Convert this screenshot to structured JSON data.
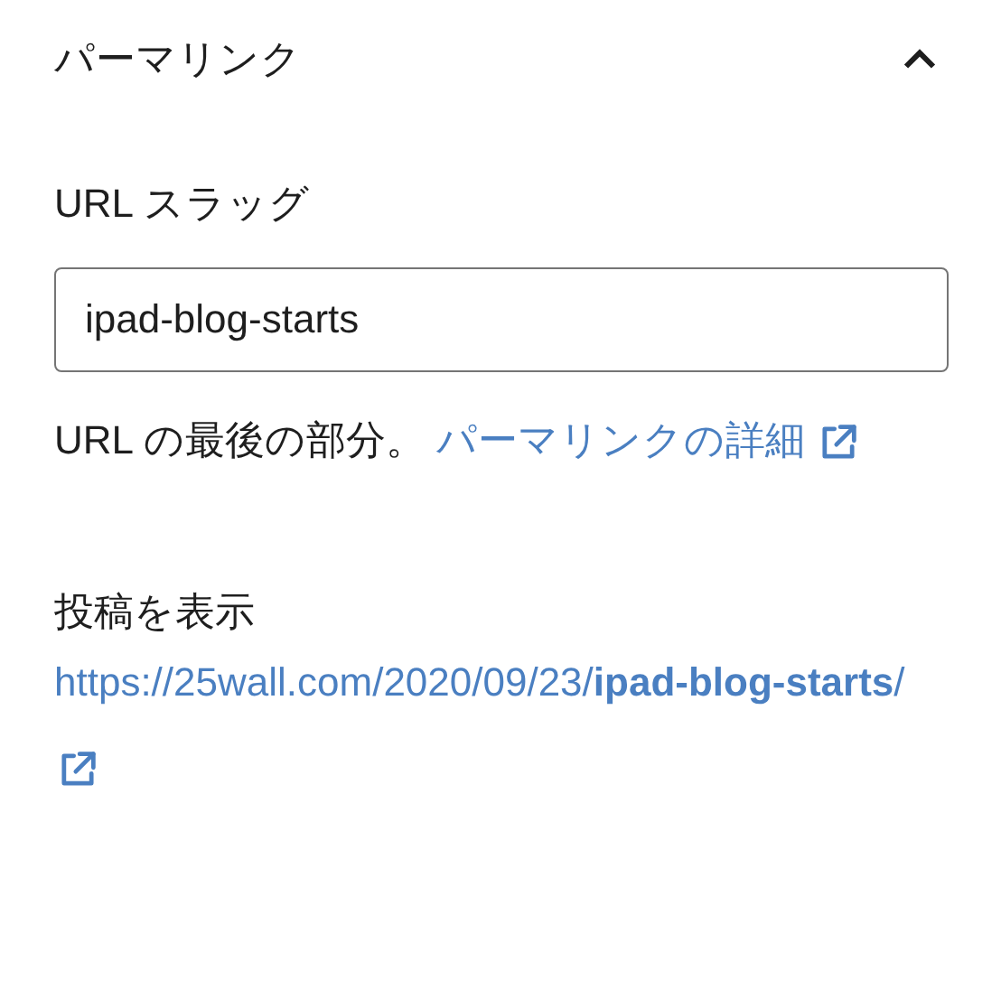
{
  "panel": {
    "title": "パーマリンク",
    "expanded": true
  },
  "slug_field": {
    "label": "URL スラッグ",
    "value": "ipad-blog-starts"
  },
  "help": {
    "text": "URL の最後の部分。",
    "link": "パーマリンクの詳細"
  },
  "view_post": {
    "label": "投稿を表示",
    "url": "https://25wall.com/2020/09/23/**ipad-blog-starts**/"
  }
}
